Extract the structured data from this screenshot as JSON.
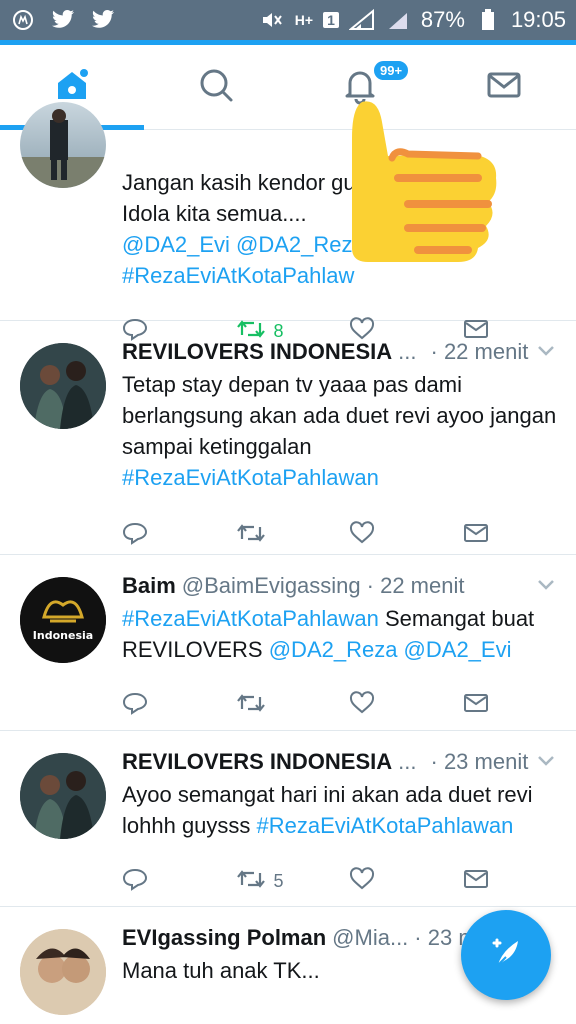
{
  "status_bar": {
    "battery": "87%",
    "time": "19:05",
    "sim_label": "1",
    "network_label": "H+",
    "icons": [
      "whatsapp-icon",
      "twitter-icon",
      "twitter-icon",
      "mute-icon",
      "signal-icon",
      "battery-icon"
    ]
  },
  "nav": {
    "tabs": [
      {
        "name": "home",
        "icon": "home-icon",
        "active": true
      },
      {
        "name": "search",
        "icon": "search-icon",
        "active": false
      },
      {
        "name": "notifications",
        "icon": "bell-icon",
        "active": false
      },
      {
        "name": "messages",
        "icon": "mail-icon",
        "active": false
      }
    ],
    "notif_badge": "99+"
  },
  "tweets": [
    {
      "name": "",
      "handle": "",
      "time": "",
      "body": [
        {
          "t": "Jangan kasih kendor gu",
          "link": false
        },
        {
          "t": "\nIdola kita semua....",
          "link": false
        },
        {
          "t": "\n@DA2_Evi @DA2_Reza",
          "link": true
        },
        {
          "t": "\n#RezaEviAtKotaPahlaw",
          "link": true
        }
      ],
      "retweets": "8",
      "retweeted": true
    },
    {
      "name": "REVILOVERS INDONESIA",
      "handle": "...",
      "time": "· 22 menit",
      "body": [
        {
          "t": "Tetap stay depan tv yaaa pas dami berlangsung akan ada duet revi ayoo jangan sampai ketinggalan ",
          "link": false
        },
        {
          "t": "#RezaEviAtKotaPahlawan",
          "link": true
        }
      ],
      "retweets": "",
      "retweeted": false
    },
    {
      "name": "Baim",
      "handle": "@BaimEvigassing",
      "time": "· 22 menit",
      "body": [
        {
          "t": "#RezaEviAtKotaPahlawan",
          "link": true
        },
        {
          "t": " Semangat buat REVILOVERS ",
          "link": false
        },
        {
          "t": "@DA2_Reza @DA2_Evi",
          "link": true
        }
      ],
      "retweets": "",
      "retweeted": false
    },
    {
      "name": "REVILOVERS INDONESIA",
      "handle": "...",
      "time": "· 23 menit",
      "body": [
        {
          "t": "Ayoo semangat hari ini akan ada duet revi lohhh guysss ",
          "link": false
        },
        {
          "t": "#RezaEviAtKotaPahlawan",
          "link": true
        }
      ],
      "retweets": "5",
      "retweeted": false
    },
    {
      "name": "EVIgassing Polman",
      "handle": "@Mia...",
      "time": "· 23 m",
      "body": [
        {
          "t": "Mana tuh anak TK...",
          "link": false
        }
      ],
      "retweets": "",
      "retweeted": false
    }
  ],
  "avatar_logo_text": "Indonesia",
  "colors": {
    "accent": "#1da1f2",
    "retweet_green": "#17bf63",
    "status_bar": "#5b7083",
    "muted": "#657786"
  }
}
